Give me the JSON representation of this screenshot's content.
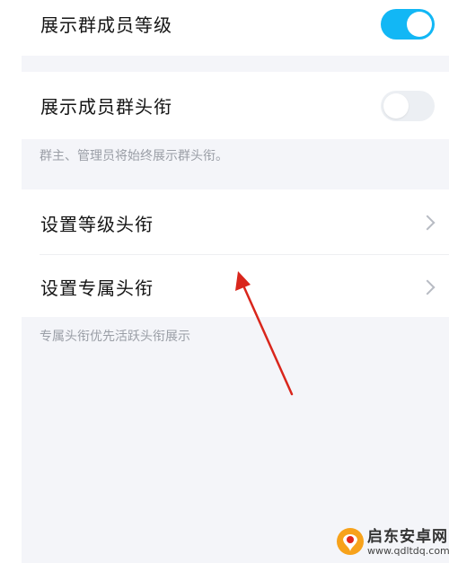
{
  "settings": {
    "show_member_level": {
      "label": "展示群成员等级",
      "state": "on"
    },
    "show_member_title": {
      "label": "展示成员群头衔",
      "state": "off"
    },
    "title_hint": "群主、管理员将始终展示群头衔。",
    "set_level_title": {
      "label": "设置等级头衔"
    },
    "set_exclusive_title": {
      "label": "设置专属头衔"
    },
    "exclusive_hint": "专属头衔优先活跃头衔展示"
  },
  "watermark": {
    "brand": "启东安卓网",
    "url": "www.qdltdq.com"
  },
  "colors": {
    "toggle_on": "#12b7f5",
    "toggle_off": "#eceff3",
    "annotation_arrow": "#d9261c",
    "page_bg": "#f4f5f9"
  },
  "icons": [
    "chevron-right-icon",
    "annotation-arrow-icon",
    "watermark-logo-icon"
  ]
}
